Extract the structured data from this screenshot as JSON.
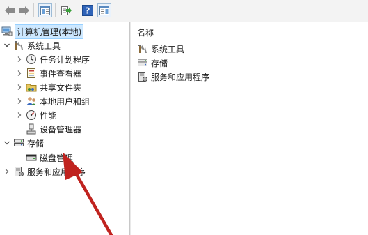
{
  "toolbar": {
    "buttons": [
      {
        "name": "back-button",
        "icon": "arrow-left-icon"
      },
      {
        "name": "forward-button",
        "icon": "arrow-right-icon"
      },
      {
        "name": "show-hide-console-tree-button",
        "icon": "console-tree-icon"
      },
      {
        "name": "export-list-button",
        "icon": "export-list-icon"
      },
      {
        "name": "help-button",
        "icon": "help-icon"
      },
      {
        "name": "show-hide-action-pane-button",
        "icon": "action-pane-icon"
      }
    ]
  },
  "tree": {
    "root": "计算机管理(本地)",
    "system_tools": "系统工具",
    "task_scheduler": "任务计划程序",
    "event_viewer": "事件查看器",
    "shared_folders": "共享文件夹",
    "local_users": "本地用户和组",
    "performance": "性能",
    "device_manager": "设备管理器",
    "storage": "存储",
    "disk_management": "磁盘管理",
    "services_apps": "服务和应用程序"
  },
  "list": {
    "header": "名称",
    "items": [
      "系统工具",
      "存储",
      "服务和应用程序"
    ]
  },
  "colors": {
    "arrow": "#c0231f",
    "selection_bg": "#cde8ff",
    "selection_border": "#99d1ff"
  }
}
